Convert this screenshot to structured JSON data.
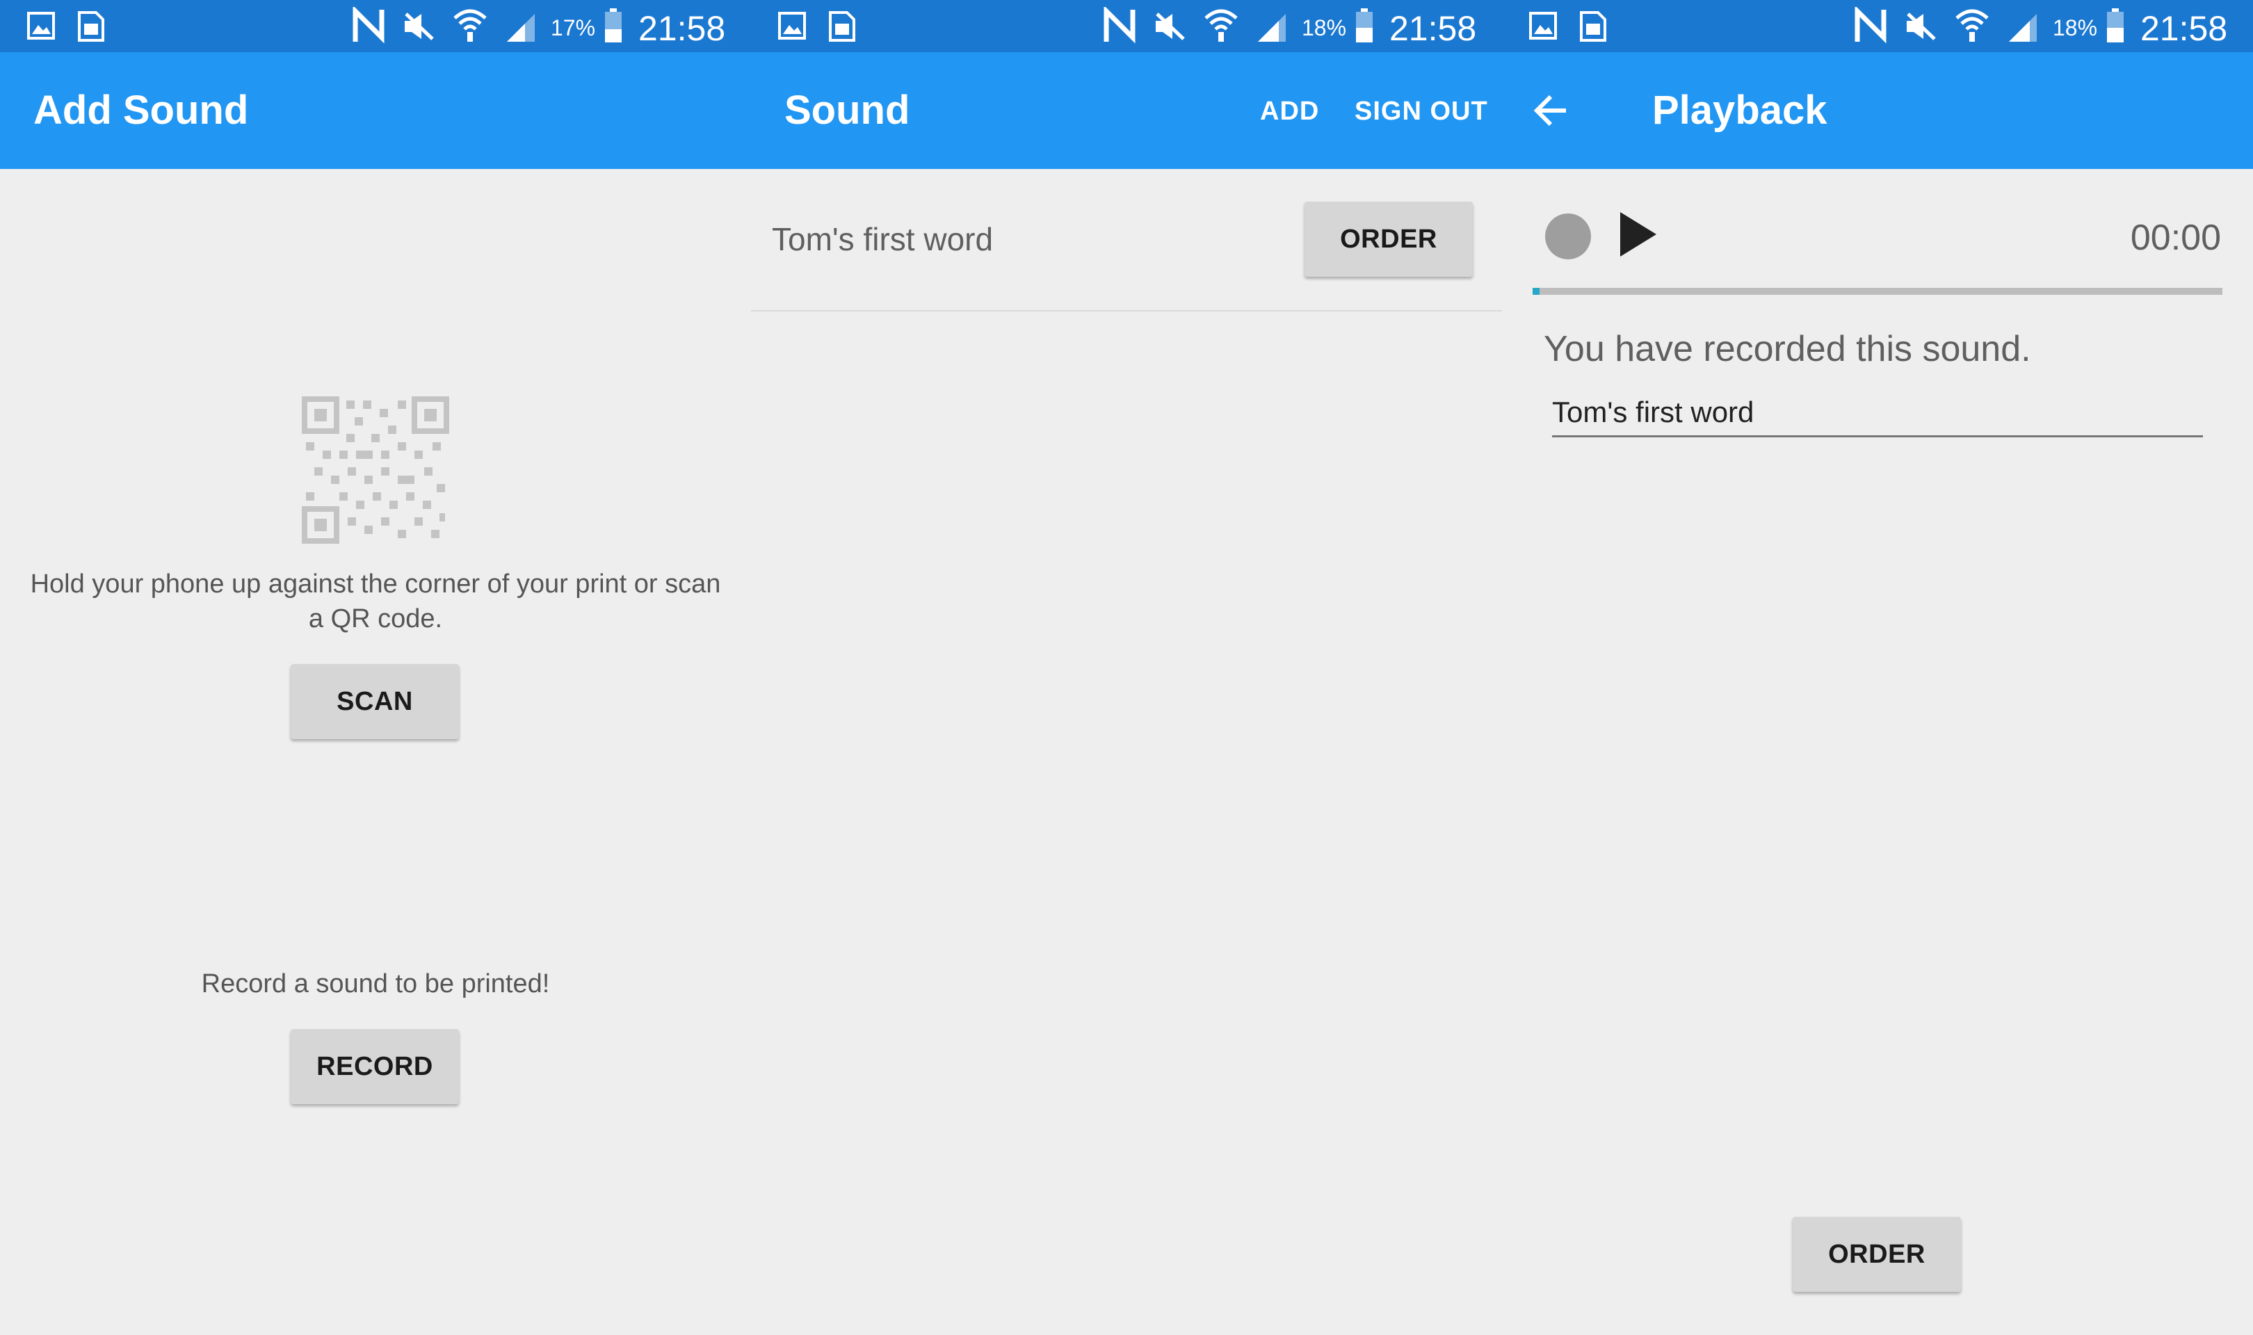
{
  "status_bar": {
    "screen1": {
      "battery": "17%",
      "time": "21:58"
    },
    "screen2": {
      "battery": "18%",
      "time": "21:58"
    },
    "screen3": {
      "battery": "18%",
      "time": "21:58"
    },
    "icons": [
      "gallery-icon",
      "sim-card-icon",
      "nfc-icon",
      "mute-icon",
      "wifi-icon",
      "signal-icon",
      "battery-icon"
    ]
  },
  "add_sound_screen": {
    "title": "Add Sound",
    "qr_instructions": "Hold your phone up against the corner of your print or scan a QR code.",
    "scan_label": "SCAN",
    "record_prompt": "Record a sound to be printed!",
    "record_label": "RECORD"
  },
  "sound_screen": {
    "title": "Sound",
    "actions": {
      "add": "ADD",
      "sign_out": "SIGN OUT"
    },
    "list": [
      {
        "name": "Tom's first word",
        "order_label": "ORDER"
      }
    ]
  },
  "playback_screen": {
    "title": "Playback",
    "timer": "00:00",
    "progress": 0,
    "recorded_message": "You have recorded this sound.",
    "sound_name_value": "Tom's first word",
    "order_label": "ORDER"
  },
  "colors": {
    "status_bar": "#1b78d1",
    "app_bar": "#2196f3",
    "background": "#eeeeee",
    "button": "#d6d6d6",
    "progress_track": "#bdbdbd",
    "progress_accent": "#26a6c9"
  }
}
